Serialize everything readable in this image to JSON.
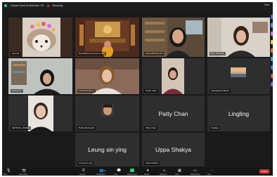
{
  "window": {
    "title": "Original Sound for Musicians: Off",
    "recording": "Recording",
    "view_label": "View"
  },
  "participants": [
    {
      "name": "user-01"
    },
    {
      "name": "Rev/ath(Ps) (ecc)apt a.CNN"
    },
    {
      "name": "Hanna Benidet-04"
    },
    {
      "name": "Bryn Kitchens"
    },
    {
      "name": "Emma Lin"
    },
    {
      "name": "Anna Brusdmen"
    },
    {
      "name": "Grace Yeah"
    },
    {
      "name": "Anastasia Rodamin"
    },
    {
      "name": "GETNOS, JASMN"
    },
    {
      "name": "Bobby Berwerds"
    },
    {
      "name": "Patty Chan",
      "display": "Patty Chan"
    },
    {
      "name": "Lingling",
      "display": "Lingling"
    },
    {
      "name": "Leung sin ying",
      "display": "Leung sin ying"
    },
    {
      "name": "Uppa Shakya",
      "display": "Uppa Shakya"
    }
  ],
  "toolbar": {
    "mute": "Mute",
    "video": "Start Video",
    "security": "Security",
    "participants": "Participants",
    "participants_count": "14",
    "chat": "Chat",
    "share": "Share Screen",
    "record": "Record",
    "reactions": "Reactions",
    "apps": "Apps",
    "whiteboards": "Whiteboards",
    "more": "More",
    "leave": "Leave"
  },
  "colors": {
    "window_bg": "#1a1a1a",
    "tile_bg": "#2e2e2e",
    "share_green": "#2ecc71",
    "leave_red": "#d9363e"
  }
}
